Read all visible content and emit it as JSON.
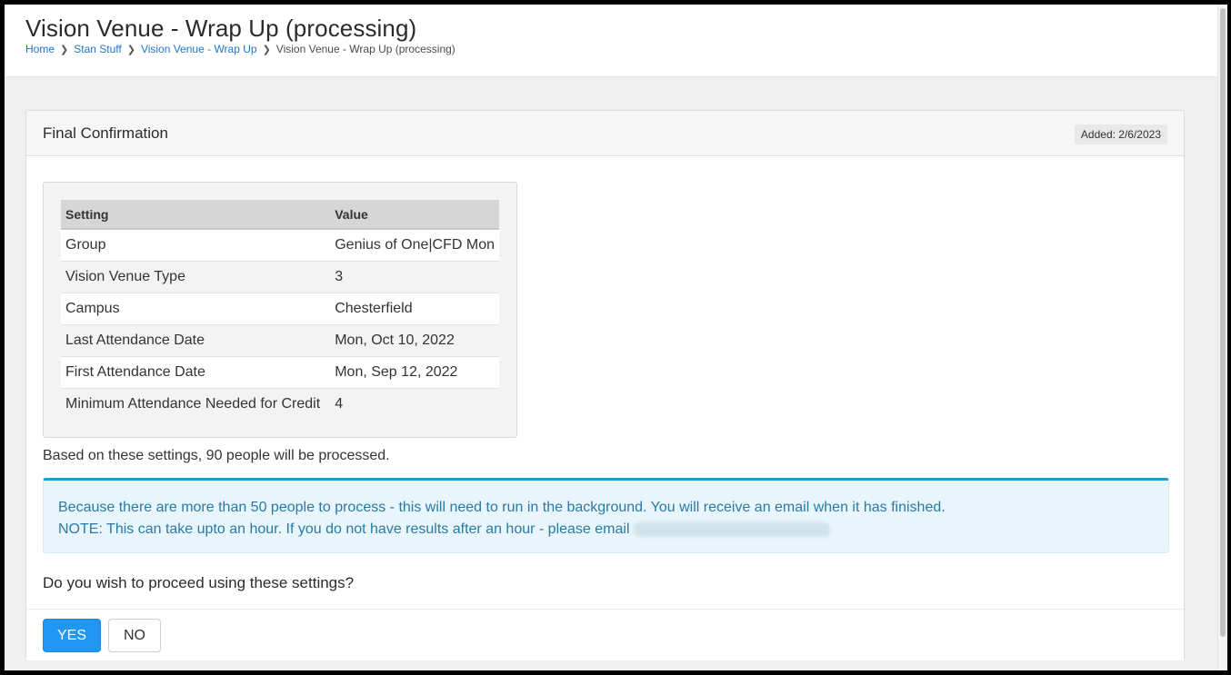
{
  "page": {
    "title": "Vision Venue - Wrap Up (processing)",
    "breadcrumbs": [
      {
        "label": "Home"
      },
      {
        "label": "Stan Stuff"
      },
      {
        "label": "Vision Venue - Wrap Up"
      },
      {
        "label": "Vision Venue - Wrap Up (processing)"
      }
    ]
  },
  "panel": {
    "title": "Final Confirmation",
    "added": "Added: 2/6/2023",
    "table": {
      "headers": [
        "Setting",
        "Value"
      ],
      "rows": [
        {
          "setting": "Group",
          "value": "Genius of One|CFD Mon"
        },
        {
          "setting": "Vision Venue Type",
          "value": "3"
        },
        {
          "setting": "Campus",
          "value": "Chesterfield"
        },
        {
          "setting": "Last Attendance Date",
          "value": "Mon, Oct 10, 2022"
        },
        {
          "setting": "First Attendance Date",
          "value": "Mon, Sep 12, 2022"
        },
        {
          "setting": "Minimum Attendance Needed for Credit",
          "value": "4"
        }
      ]
    },
    "process_text": "Based on these settings, 90 people will be processed.",
    "alert": {
      "line1": "Because there are more than 50 people to process - this will need to run in the background. You will receive an email when it has finished.",
      "line2": "NOTE: This can take upto an hour. If you do not have results after an hour - please email"
    },
    "question": "Do you wish to proceed using these settings?",
    "buttons": {
      "yes": "YES",
      "no": "NO"
    }
  },
  "colors": {
    "accent": "#2196f3",
    "link": "#1f76c7",
    "info_border": "#1c9bd6",
    "info_bg": "#e8f5fb"
  },
  "icons": {
    "breadcrumb_separator": "chevron-right-icon"
  }
}
